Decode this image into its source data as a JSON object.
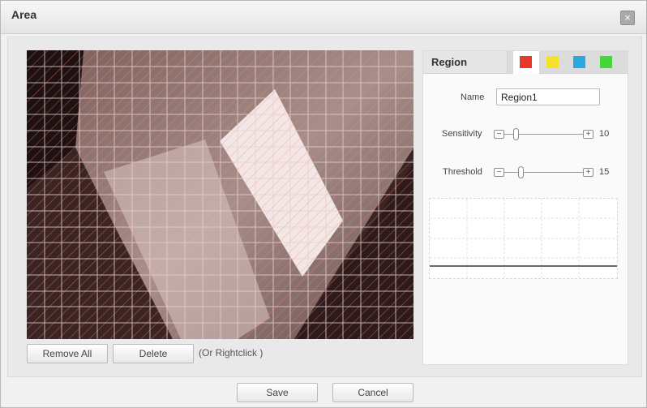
{
  "dialog": {
    "title": "Area",
    "close_glyph": "×"
  },
  "video": {
    "remove_all_label": "Remove All",
    "delete_label": "Delete",
    "hint": "(Or Rightclick )"
  },
  "panel": {
    "tab_label": "Region",
    "colors": [
      {
        "name": "red",
        "hex": "#e8382a"
      },
      {
        "name": "yellow",
        "hex": "#f6e12a"
      },
      {
        "name": "blue",
        "hex": "#2aa9e0"
      },
      {
        "name": "green",
        "hex": "#45d735"
      }
    ],
    "name_label": "Name",
    "name_value": "Region1",
    "sensitivity_label": "Sensitivity",
    "sensitivity_value": "10",
    "threshold_label": "Threshold",
    "threshold_value": "15",
    "minus_glyph": "−",
    "plus_glyph": "+"
  },
  "footer": {
    "save_label": "Save",
    "cancel_label": "Cancel"
  }
}
